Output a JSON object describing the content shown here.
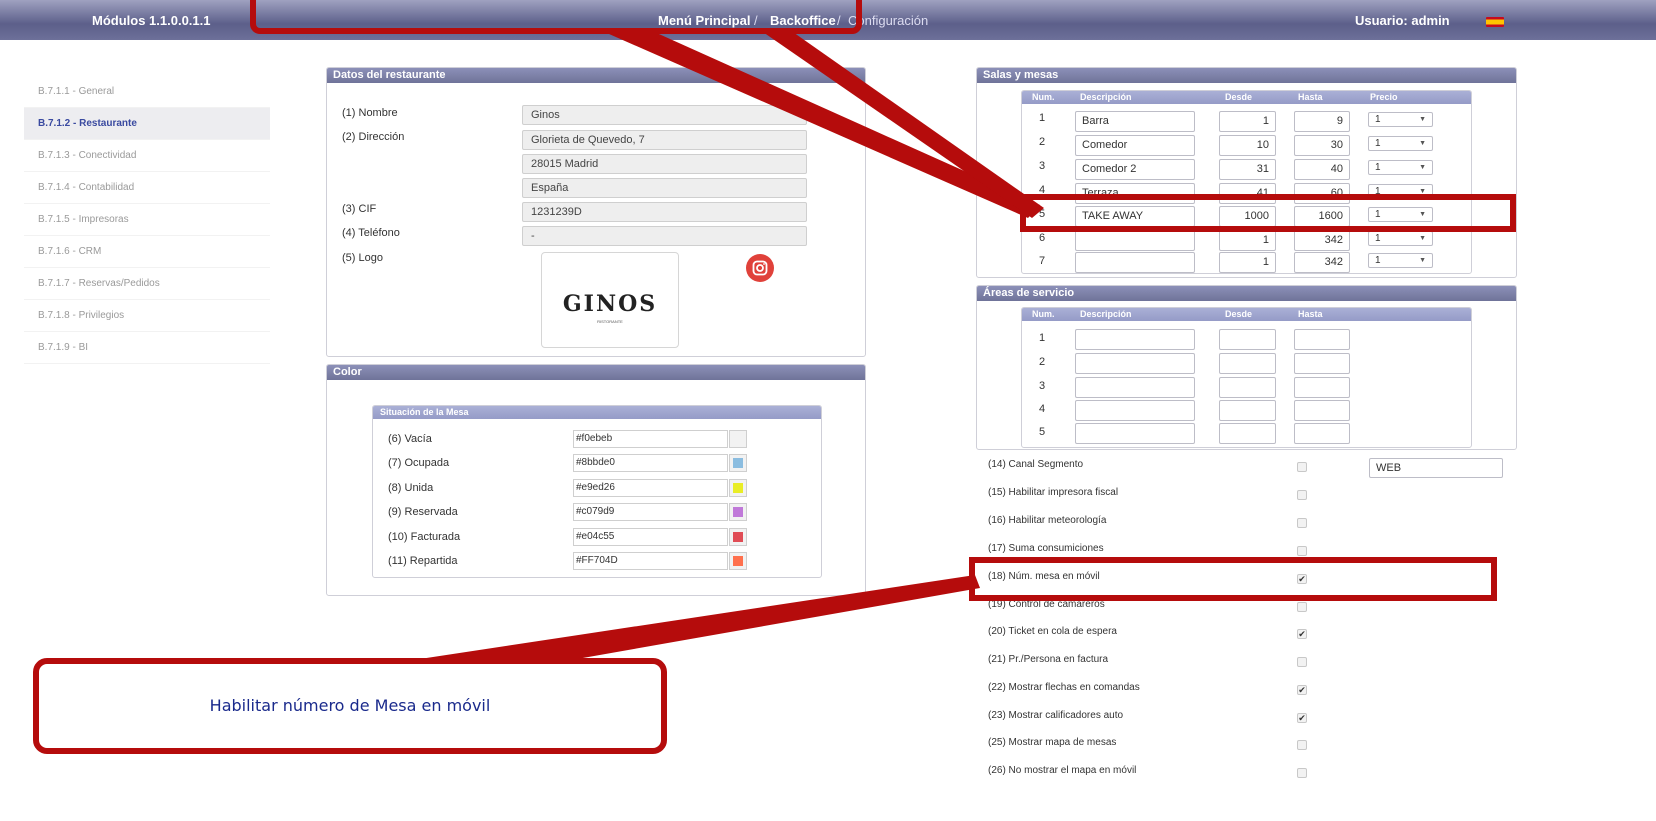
{
  "topbar": {
    "module": "Módulos 1.1.0.0.1.1",
    "crumb_menu": "Menú Principal",
    "sep": "/",
    "crumb_backoffice": "Backoffice",
    "crumb_config": "Configuración",
    "user": "Usuario: admin",
    "flag_icon": "spain-flag-icon"
  },
  "sidebar": {
    "items": [
      {
        "label": "B.7.1.1 - General"
      },
      {
        "label": "B.7.1.2 - Restaurante"
      },
      {
        "label": "B.7.1.3 - Conectividad"
      },
      {
        "label": "B.7.1.4 - Contabilidad"
      },
      {
        "label": "B.7.1.5 - Impresoras"
      },
      {
        "label": "B.7.1.6 - CRM"
      },
      {
        "label": "B.7.1.7 - Reservas/Pedidos"
      },
      {
        "label": "B.7.1.8 - Privilegios"
      },
      {
        "label": "B.7.1.9 - BI"
      }
    ],
    "active_index": 1
  },
  "restaurant": {
    "title": "Datos del restaurante",
    "name_label": "(1) Nombre",
    "name_value": "Ginos",
    "address_label": "(2) Dirección",
    "address_line1": "Glorieta de Quevedo, 7",
    "address_line2": "28015 Madrid",
    "address_line3": "España",
    "cif_label": "(3) CIF",
    "cif_value": "1231239D",
    "phone_label": "(4) Teléfono",
    "phone_value": "-",
    "logo_label": "(5) Logo",
    "logo_text": "GINOS",
    "logo_subtext": "RISTORANTE",
    "upload_icon": "instagram-icon"
  },
  "color": {
    "title": "Color",
    "subtitle": "Situación de la Mesa",
    "rows": [
      {
        "label": "(6) Vacía",
        "value": "#f0ebeb",
        "swatch": ""
      },
      {
        "label": "(7) Ocupada",
        "value": "#8bbde0",
        "swatch": "#8bbde0"
      },
      {
        "label": "(8) Unida",
        "value": "#e9ed26",
        "swatch": "#e9ed26"
      },
      {
        "label": "(9) Reservada",
        "value": "#c079d9",
        "swatch": "#c079d9"
      },
      {
        "label": "(10) Facturada",
        "value": "#e04c55",
        "swatch": "#e04c55"
      },
      {
        "label": "(11) Repartida",
        "value": "#FF704D",
        "swatch": "#FF704D"
      }
    ]
  },
  "salas": {
    "title": "Salas y mesas",
    "headers": [
      "Num.",
      "Descripción",
      "Desde",
      "Hasta",
      "Precio"
    ],
    "rows": [
      {
        "num": "1",
        "desc": "Barra",
        "desde": "1",
        "hasta": "9",
        "precio": "1"
      },
      {
        "num": "2",
        "desc": "Comedor",
        "desde": "10",
        "hasta": "30",
        "precio": "1"
      },
      {
        "num": "3",
        "desc": "Comedor 2",
        "desde": "31",
        "hasta": "40",
        "precio": "1"
      },
      {
        "num": "4",
        "desc": "Terraza",
        "desde": "41",
        "hasta": "60",
        "precio": "1"
      },
      {
        "num": "5",
        "desc": "TAKE AWAY",
        "desde": "1000",
        "hasta": "1600",
        "precio": "1"
      },
      {
        "num": "6",
        "desc": "",
        "desde": "1",
        "hasta": "342",
        "precio": "1"
      },
      {
        "num": "7",
        "desc": "",
        "desde": "1",
        "hasta": "342",
        "precio": "1"
      }
    ]
  },
  "areas": {
    "title": "Áreas de servicio",
    "headers": [
      "Num.",
      "Descripción",
      "Desde",
      "Hasta"
    ],
    "rows": [
      {
        "num": "1"
      },
      {
        "num": "2"
      },
      {
        "num": "3"
      },
      {
        "num": "4"
      },
      {
        "num": "5"
      }
    ]
  },
  "options": [
    {
      "label": "(14) Canal Segmento",
      "checked": false,
      "text_value": "WEB"
    },
    {
      "label": "(15) Habilitar impresora fiscal",
      "checked": false
    },
    {
      "label": "(16) Habilitar meteorología",
      "checked": false
    },
    {
      "label": "(17) Suma consumiciones",
      "checked": false
    },
    {
      "label": "(18) Núm. mesa en móvil",
      "checked": true
    },
    {
      "label": "(19) Control de camareros",
      "checked": false
    },
    {
      "label": "(20) Ticket en cola de espera",
      "checked": true
    },
    {
      "label": "(21) Pr./Persona en factura",
      "checked": false
    },
    {
      "label": "(22) Mostrar flechas en comandas",
      "checked": true
    },
    {
      "label": "(23) Mostrar calificadores auto",
      "checked": true
    },
    {
      "label": "(25) Mostrar mapa de mesas",
      "checked": false
    },
    {
      "label": "(26) No mostrar el mapa en móvil",
      "checked": false
    }
  ],
  "callout": {
    "text": "Habilitar  número de Mesa en móvil",
    "color": "#b50c0c"
  }
}
